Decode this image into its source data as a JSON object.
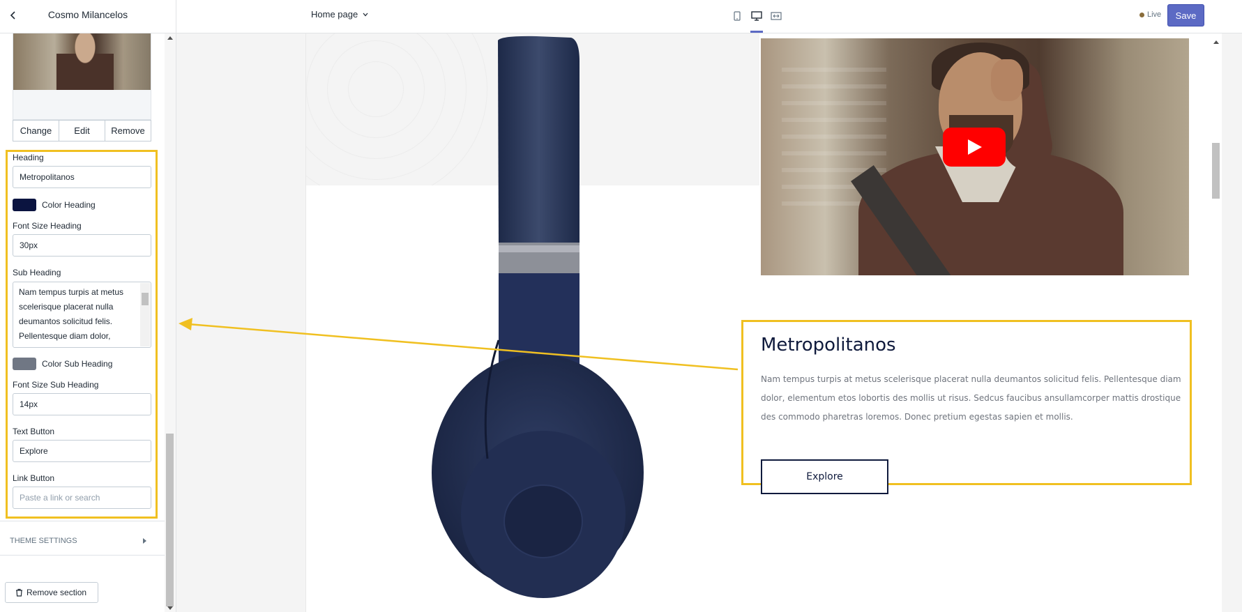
{
  "header": {
    "shop_name": "Cosmo Milancelos",
    "page_select": "Home page",
    "live_label": "Live",
    "save_label": "Save"
  },
  "image_actions": [
    "Change",
    "Edit",
    "Remove"
  ],
  "settings": {
    "heading_label": "Heading",
    "heading_value": "Metropolitanos",
    "color_heading_label": "Color Heading",
    "color_heading": "#0b1440",
    "font_size_heading_label": "Font Size Heading",
    "font_size_heading_value": "30px",
    "sub_heading_label": "Sub Heading",
    "sub_heading_value": "Nam tempus turpis at metus scelerisque placerat nulla deumantos solicitud felis. Pellentesque diam dolor,",
    "color_sub_heading_label": "Color Sub Heading",
    "color_sub_heading": "#707784",
    "font_size_sub_heading_label": "Font Size Sub Heading",
    "font_size_sub_heading_value": "14px",
    "text_button_label": "Text Button",
    "text_button_value": "Explore",
    "link_button_label": "Link Button",
    "link_button_placeholder": "Paste a link or search"
  },
  "theme_settings_label": "THEME SETTINGS",
  "remove_section_label": "Remove section",
  "preview": {
    "heading": "Metropolitanos",
    "sub_heading": "Nam tempus turpis at metus scelerisque placerat nulla deumantos solicitud felis. Pellentesque diam dolor, elementum etos lobortis des mollis ut risus. Sedcus faucibus ansullamcorper mattis drostique des commodo pharetras loremos. Donec pretium egestas sapien et mollis.",
    "button_label": "Explore"
  },
  "colors": {
    "accent": "#5c6ac4",
    "highlight": "#f0c021"
  }
}
